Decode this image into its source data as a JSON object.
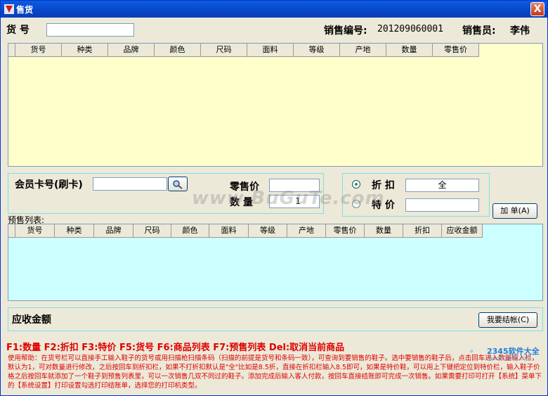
{
  "window": {
    "title": "售货",
    "close_glyph": "X"
  },
  "header": {
    "item_no_label": "货  号",
    "item_no_value": "",
    "sale_no_label": "销售编号:",
    "sale_no_value": "201209060001",
    "seller_label": "销售员:",
    "seller_value": "李伟"
  },
  "product_grid": {
    "columns": [
      "货号",
      "种类",
      "品牌",
      "颜色",
      "尺码",
      "面料",
      "等级",
      "产地",
      "数量",
      "零售价"
    ]
  },
  "member": {
    "label": "会员卡号(刷卡)",
    "value": "",
    "search_icon": "search-icon"
  },
  "price": {
    "retail_label": "零售价",
    "retail_value": "",
    "qty_label": "数  量",
    "qty_value": "1"
  },
  "discount": {
    "discount_label": "折  扣",
    "discount_value": "全",
    "special_label": "特  价",
    "special_value": "",
    "add_button": "加 单(A)"
  },
  "presale": {
    "label": "预售列表:",
    "columns": [
      "货号",
      "种类",
      "品牌",
      "尺码",
      "颜色",
      "面料",
      "等级",
      "产地",
      "零售价",
      "数量",
      "折扣",
      "应收金额"
    ]
  },
  "due": {
    "label": "应收金额",
    "checkout_button": "我要结帐(C)"
  },
  "hotkeys": "F1:数量 F2:折扣 F3:特价 F5:货号 F6:商品列表 F7:预售列表 Del:取消当前商品",
  "help": "使用帮助：在货号栏可以直接手工输入鞋子的货号或用扫描枪扫描条码（扫描的前提是货号和条码一致），可查询到要销售的鞋子。选中要销售的鞋子后，点击回车进入数量输入栏，默认为1，可对数量进行修改，之后按回车到折扣栏，如果不打折扣默认是\"全\"比如是8.5折，直接在折扣栏输入8.5即可，如果是特价鞋，可以用上下键把定位到特价栏，输入鞋子价格之后按回车就添加了一个鞋子到预售列表里，可以一次销售几双不同过的鞋子。添加完成后输入客人付款，按回车直接结账即可完成一次销售。如果需要打印可打开【系统】菜单下的【系统设置】打印设置勾选打印结账单，选择您的打印机类型。",
  "watermark": "www.BuGuTe.com",
  "logo": {
    "text": "2345软件大全",
    "sub": "www.2345.com"
  },
  "colors": {
    "grid_bg": "#FFFFCC",
    "panel_border": "#7CE1E7",
    "hint_red": "#E00000",
    "title_blue": "#0A5DDF"
  }
}
